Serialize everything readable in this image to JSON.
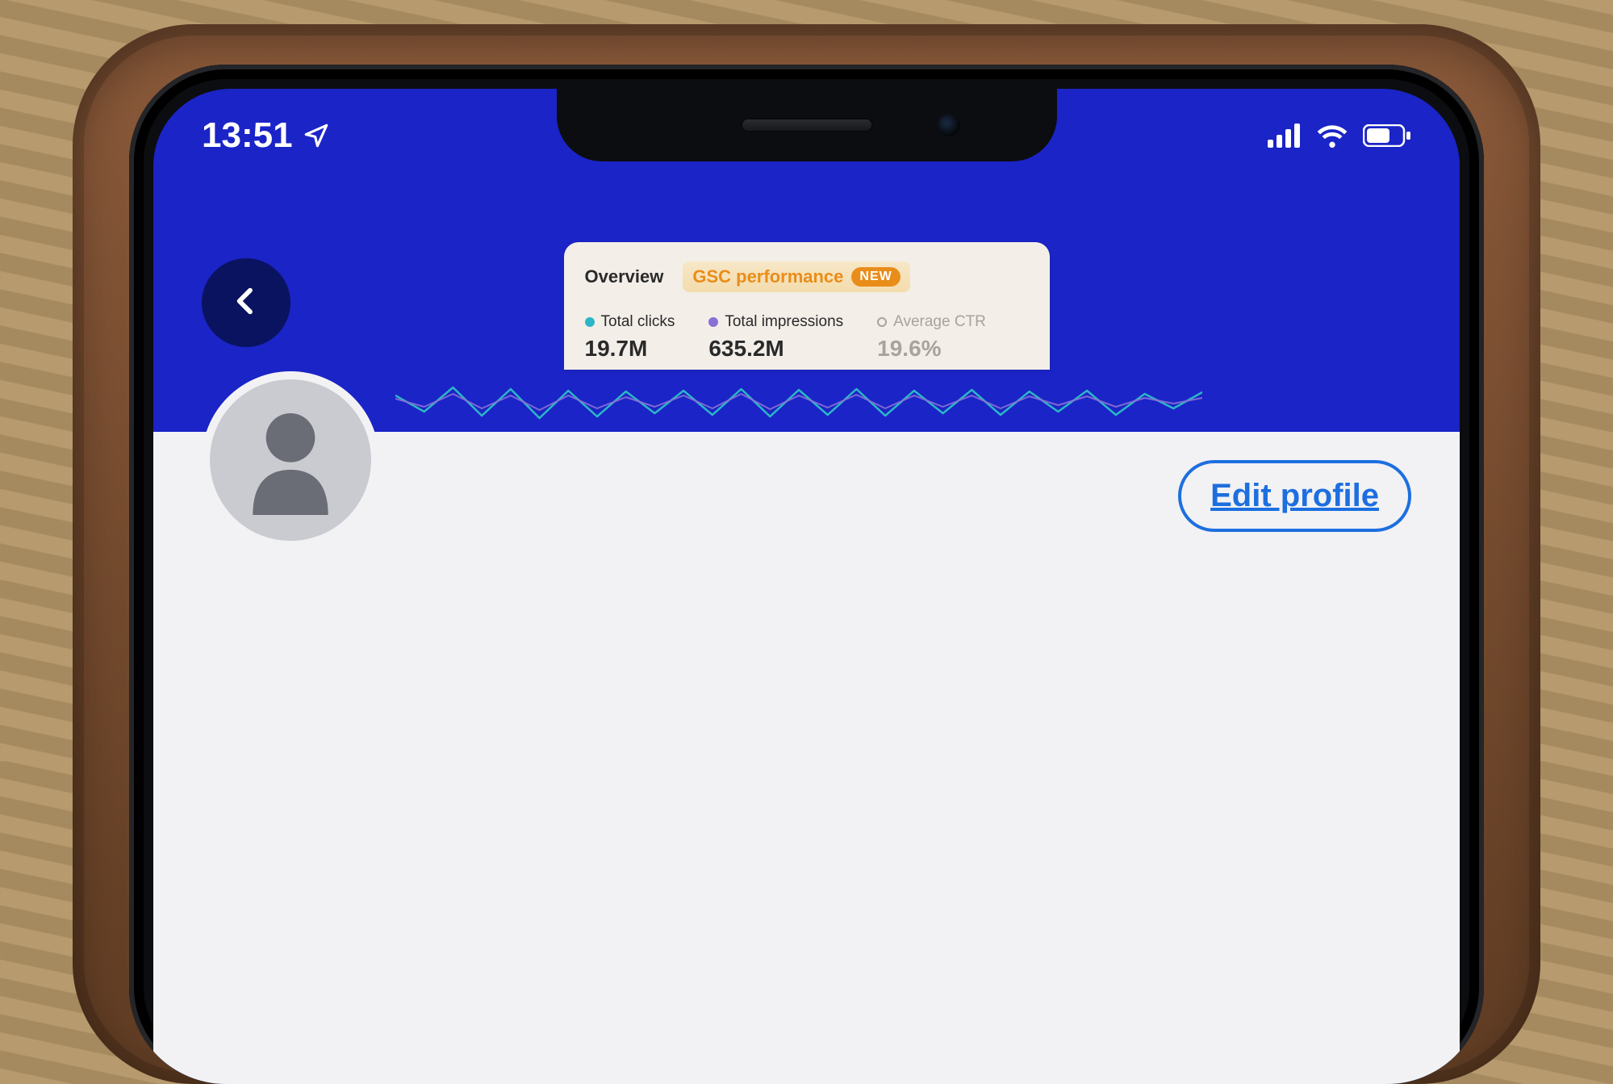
{
  "status_bar": {
    "time": "13:51",
    "location_active": true,
    "signal_bars": 4,
    "wifi": true,
    "battery_level": 0.6
  },
  "header": {
    "back_label": "Back"
  },
  "banner_card": {
    "tabs": {
      "overview": "Overview",
      "gsc": "GSC performance",
      "new_badge": "NEW"
    },
    "metrics": {
      "clicks": {
        "label": "Total clicks",
        "value": "19.7M",
        "color": "#2bb6c7"
      },
      "impressions": {
        "label": "Total impressions",
        "value": "635.2M",
        "color": "#8a6fd6"
      },
      "ctr": {
        "label": "Average CTR",
        "value": "19.6%",
        "dim": true
      }
    }
  },
  "profile": {
    "edit_label": "Edit profile"
  },
  "chart_data": {
    "type": "line",
    "title": "GSC performance",
    "xlabel": "",
    "ylabel": "",
    "series": [
      {
        "name": "Total clicks",
        "color": "#2bb6c7",
        "values": [
          50,
          30,
          60,
          25,
          58,
          22,
          56,
          24,
          55,
          28,
          56,
          26,
          58,
          24,
          57,
          26,
          58,
          25,
          56,
          28,
          57,
          26,
          55,
          30,
          56,
          26,
          52,
          34,
          54
        ]
      },
      {
        "name": "Total impressions",
        "color": "#8a6fd6",
        "values": [
          46,
          36,
          52,
          34,
          50,
          32,
          50,
          34,
          48,
          36,
          50,
          34,
          52,
          33,
          50,
          35,
          51,
          34,
          50,
          36,
          50,
          34,
          49,
          38,
          49,
          36,
          47,
          40,
          47
        ]
      }
    ],
    "ylim": [
      0,
      80
    ]
  }
}
